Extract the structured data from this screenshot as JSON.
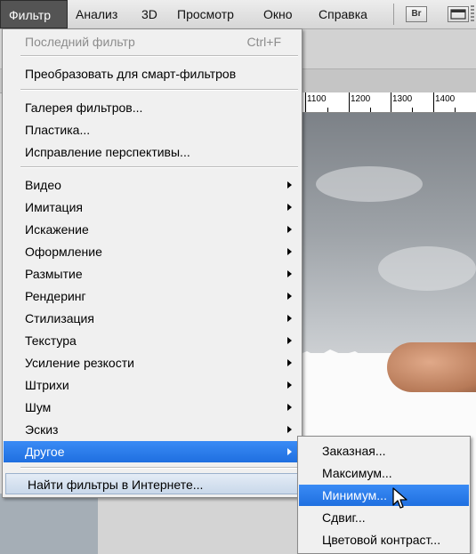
{
  "menubar": {
    "items": [
      "Фильтр",
      "Анализ",
      "3D",
      "Просмотр",
      "Окно",
      "Справка"
    ],
    "bridge_label": "Br"
  },
  "ruler": {
    "labels": [
      "1100",
      "1200",
      "1300",
      "1400"
    ]
  },
  "filter_menu": {
    "last_filter": "Последний фильтр",
    "last_filter_shortcut": "Ctrl+F",
    "convert_smart": "Преобразовать для смарт-фильтров",
    "gallery": "Галерея фильтров...",
    "liquify": "Пластика...",
    "vanishing_point": "Исправление перспективы...",
    "groups": [
      "Видео",
      "Имитация",
      "Искажение",
      "Оформление",
      "Размытие",
      "Рендеринг",
      "Стилизация",
      "Текстура",
      "Усиление резкости",
      "Штрихи",
      "Шум",
      "Эскиз",
      "Другое"
    ],
    "find_online": "Найти фильтры в Интернете..."
  },
  "other_submenu": {
    "items": [
      "Заказная...",
      "Максимум...",
      "Минимум...",
      "Сдвиг...",
      "Цветовой контраст..."
    ],
    "highlighted": "Минимум..."
  },
  "colors": {
    "highlight": "#2b7cea",
    "menu_bg": "#f0f0f0",
    "active_menu": "#545454"
  }
}
